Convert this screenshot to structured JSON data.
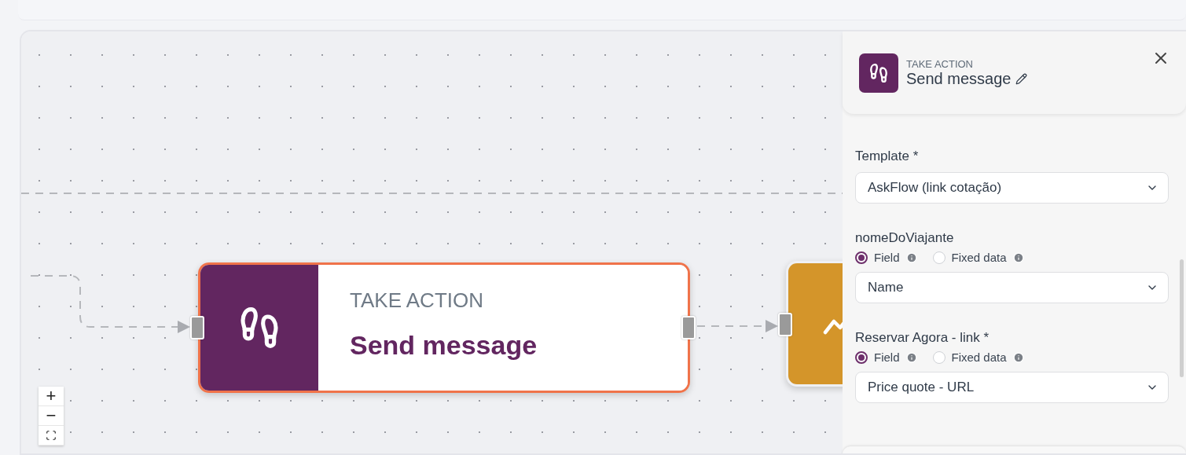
{
  "canvas": {
    "nodes": [
      {
        "kind": "action",
        "category": "TAKE ACTION",
        "title": "Send message",
        "selected": true
      },
      {
        "kind": "condition",
        "selected": false
      }
    ],
    "zoom_controls": [
      {
        "kind": "zoom_in",
        "label": "+"
      },
      {
        "kind": "zoom_out",
        "label": "−"
      },
      {
        "kind": "fit"
      }
    ]
  },
  "panel": {
    "category": "TAKE ACTION",
    "title": "Send message",
    "fields": [
      {
        "kind": "select",
        "label": "Template *",
        "value": "AskFlow (link cotação)"
      },
      {
        "kind": "mapping",
        "label": "nomeDoViajante",
        "options": [
          {
            "label": "Field",
            "selected": true
          },
          {
            "label": "Fixed data",
            "selected": false
          }
        ],
        "value": "Name"
      },
      {
        "kind": "mapping",
        "label": "Reservar Agora - link *",
        "options": [
          {
            "label": "Field",
            "selected": true
          },
          {
            "label": "Fixed data",
            "selected": false
          }
        ],
        "value": "Price quote - URL"
      }
    ]
  }
}
